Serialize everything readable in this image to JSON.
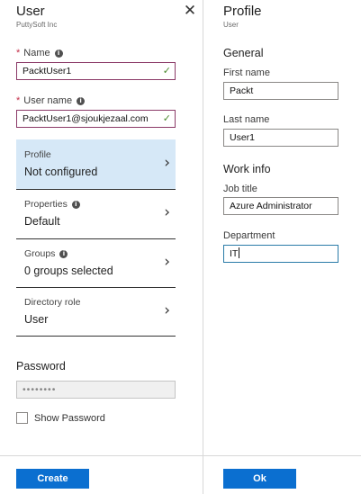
{
  "user_blade": {
    "title": "User",
    "subtitle": "PuttySoft Inc",
    "close_glyph": "✕",
    "name": {
      "label": "Name",
      "required_mark": "*",
      "value": "PacktUser1"
    },
    "user_name": {
      "label": "User name",
      "required_mark": "*",
      "value": "PacktUser1@sjoukjezaal.com"
    },
    "nav_rows": [
      {
        "label": "Profile",
        "value": "Not configured",
        "selected": true
      },
      {
        "label": "Properties",
        "value": "Default",
        "info": true
      },
      {
        "label": "Groups",
        "value": "0 groups selected",
        "info": true
      },
      {
        "label": "Directory role",
        "value": "User"
      }
    ],
    "password": {
      "label": "Password",
      "value": "••••••••"
    },
    "show_password_label": "Show Password",
    "create_button": "Create"
  },
  "profile_blade": {
    "title": "Profile",
    "subtitle": "User",
    "general_heading": "General",
    "first_name": {
      "label": "First name",
      "value": "Packt"
    },
    "last_name": {
      "label": "Last name",
      "value": "User1"
    },
    "work_heading": "Work info",
    "job_title": {
      "label": "Job title",
      "value": "Azure Administrator"
    },
    "department": {
      "label": "Department",
      "value": "IT"
    },
    "ok_button": "Ok"
  },
  "colors": {
    "accent": "#0b6fd0",
    "selected_row": "#d6e8f7",
    "required": "#c4314b",
    "valid_check": "#4a8a2e"
  },
  "icons": {
    "info": "info-icon",
    "close": "close-icon",
    "chevron": "chevron-right-icon",
    "check": "checkmark-icon"
  }
}
